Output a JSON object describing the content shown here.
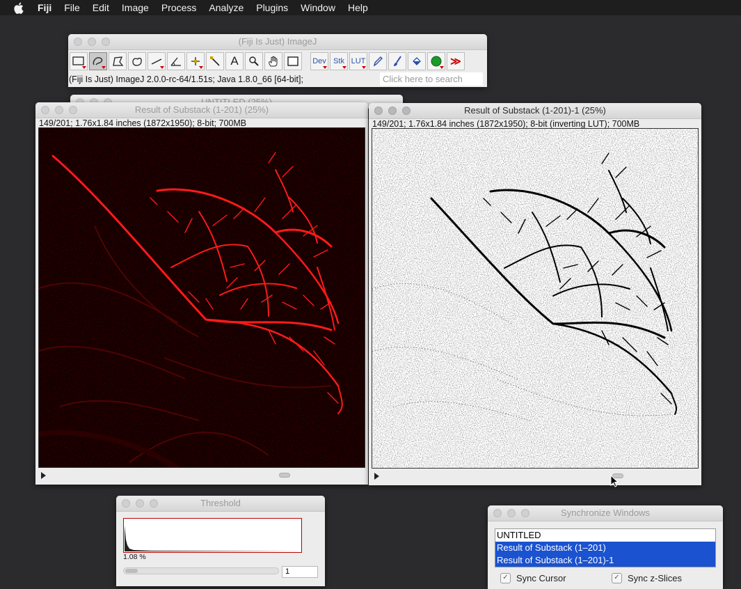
{
  "menubar": {
    "app": "Fiji",
    "items": [
      "File",
      "Edit",
      "Image",
      "Process",
      "Analyze",
      "Plugins",
      "Window",
      "Help"
    ]
  },
  "imagej": {
    "title": "(Fiji Is Just) ImageJ",
    "status": "(Fiji Is Just) ImageJ 2.0.0-rc-64/1.51s; Java 1.8.0_66 [64-bit];",
    "search_placeholder": "Click here to search",
    "tools": {
      "text": "A",
      "dev": "Dev",
      "stk": "Stk",
      "lut": "LUT",
      "more": "≫"
    }
  },
  "untitled_window": {
    "title": "UNTITLED (25%)"
  },
  "left_image": {
    "title": "Result of Substack (1-201) (25%)",
    "info": "149/201; 1.76x1.84 inches (1872x1950); 8-bit; 700MB",
    "slice_position": 0.74
  },
  "right_image": {
    "title": "Result of Substack (1-201)-1 (25%)",
    "info": "149/201; 1.76x1.84 inches (1872x1950); 8-bit (inverting LUT); 700MB",
    "slice_position": 0.74
  },
  "threshold": {
    "title": "Threshold",
    "percent": "1.08 %",
    "value": "1"
  },
  "sync": {
    "title": "Synchronize Windows",
    "items": [
      {
        "label": "UNTITLED",
        "selected": false
      },
      {
        "label": "Result of Substack (1–201)",
        "selected": true
      },
      {
        "label": "Result of Substack (1–201)-1",
        "selected": true
      }
    ],
    "sync_cursor": "Sync Cursor",
    "sync_slices": "Sync z-Slices"
  },
  "colors": {
    "desktop": "#2b2b2d",
    "red_channel": "#ff1a1a",
    "selection_blue": "#1a52cf"
  }
}
